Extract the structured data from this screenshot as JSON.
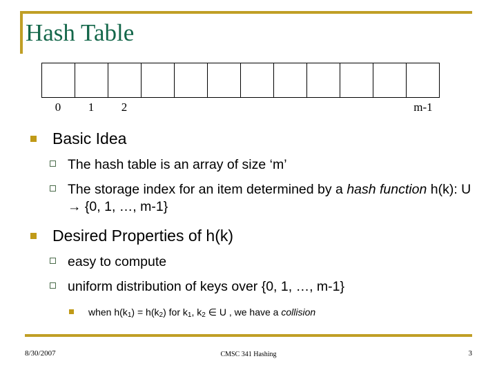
{
  "slide": {
    "title": "Hash Table",
    "title_color": "#14674A",
    "accent_color": "#C09F26",
    "bullet_color": "#C09A18",
    "hollow_bullet_color": "#4A6B4A"
  },
  "diagram": {
    "name": "hash-table-array",
    "cell_count": 12,
    "index_labels": {
      "first": "0",
      "second": "1",
      "third": "2",
      "last": "m-1"
    }
  },
  "content": {
    "sections": [
      {
        "heading": "Basic Idea",
        "points": [
          {
            "text": "The hash table is an array of size ‘m’"
          },
          {
            "text_part1": "The storage index for an item determined by a ",
            "italic1": "hash function",
            "text_part2": "  h(k):  U → {0, 1, …, m-1}"
          }
        ]
      },
      {
        "heading": "Desired Properties of h(k)",
        "points": [
          {
            "text": "easy to compute"
          },
          {
            "text": "uniform distribution of keys over {0, 1, …, m-1}"
          }
        ],
        "subpoint": {
          "prefix": "when h(k",
          "sub1": "1",
          "mid1": ") = h(k",
          "sub2": "2",
          "mid2": ") for k",
          "sub3": "1",
          "mid3": ", k",
          "sub4": "2",
          "mid4": " ∈ U , we have a ",
          "italic": "collision"
        }
      }
    ]
  },
  "footer": {
    "date": "8/30/2007",
    "center": "CMSC 341 Hashing",
    "page": "3"
  }
}
